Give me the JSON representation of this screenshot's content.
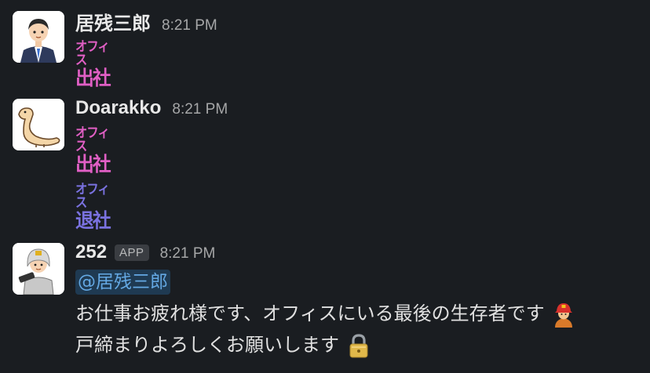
{
  "messages": [
    {
      "user": "居残三郎",
      "time": "8:21 PM",
      "avatar": "businessman-avatar",
      "stamps": [
        {
          "line1": "オフィス",
          "line2": "出社",
          "color": "#e05fc4"
        }
      ]
    },
    {
      "user": "Doarakko",
      "time": "8:21 PM",
      "avatar": "dinosaur-avatar",
      "stamps": [
        {
          "line1": "オフィス",
          "line2": "出社",
          "color": "#e05fc4"
        },
        {
          "line1": "オフィス",
          "line2": "退社",
          "color": "#7a72e0"
        }
      ]
    },
    {
      "user": "252",
      "badge": "APP",
      "time": "8:21 PM",
      "avatar": "firefighter-avatar",
      "mention": "@居残三郎",
      "lines": [
        "お仕事お疲れ様です、オフィスにいる最後の生存者です",
        "戸締まりよろしくお願いします"
      ],
      "line_icons": [
        "firefighter-emoji",
        "lock-emoji"
      ]
    }
  ]
}
